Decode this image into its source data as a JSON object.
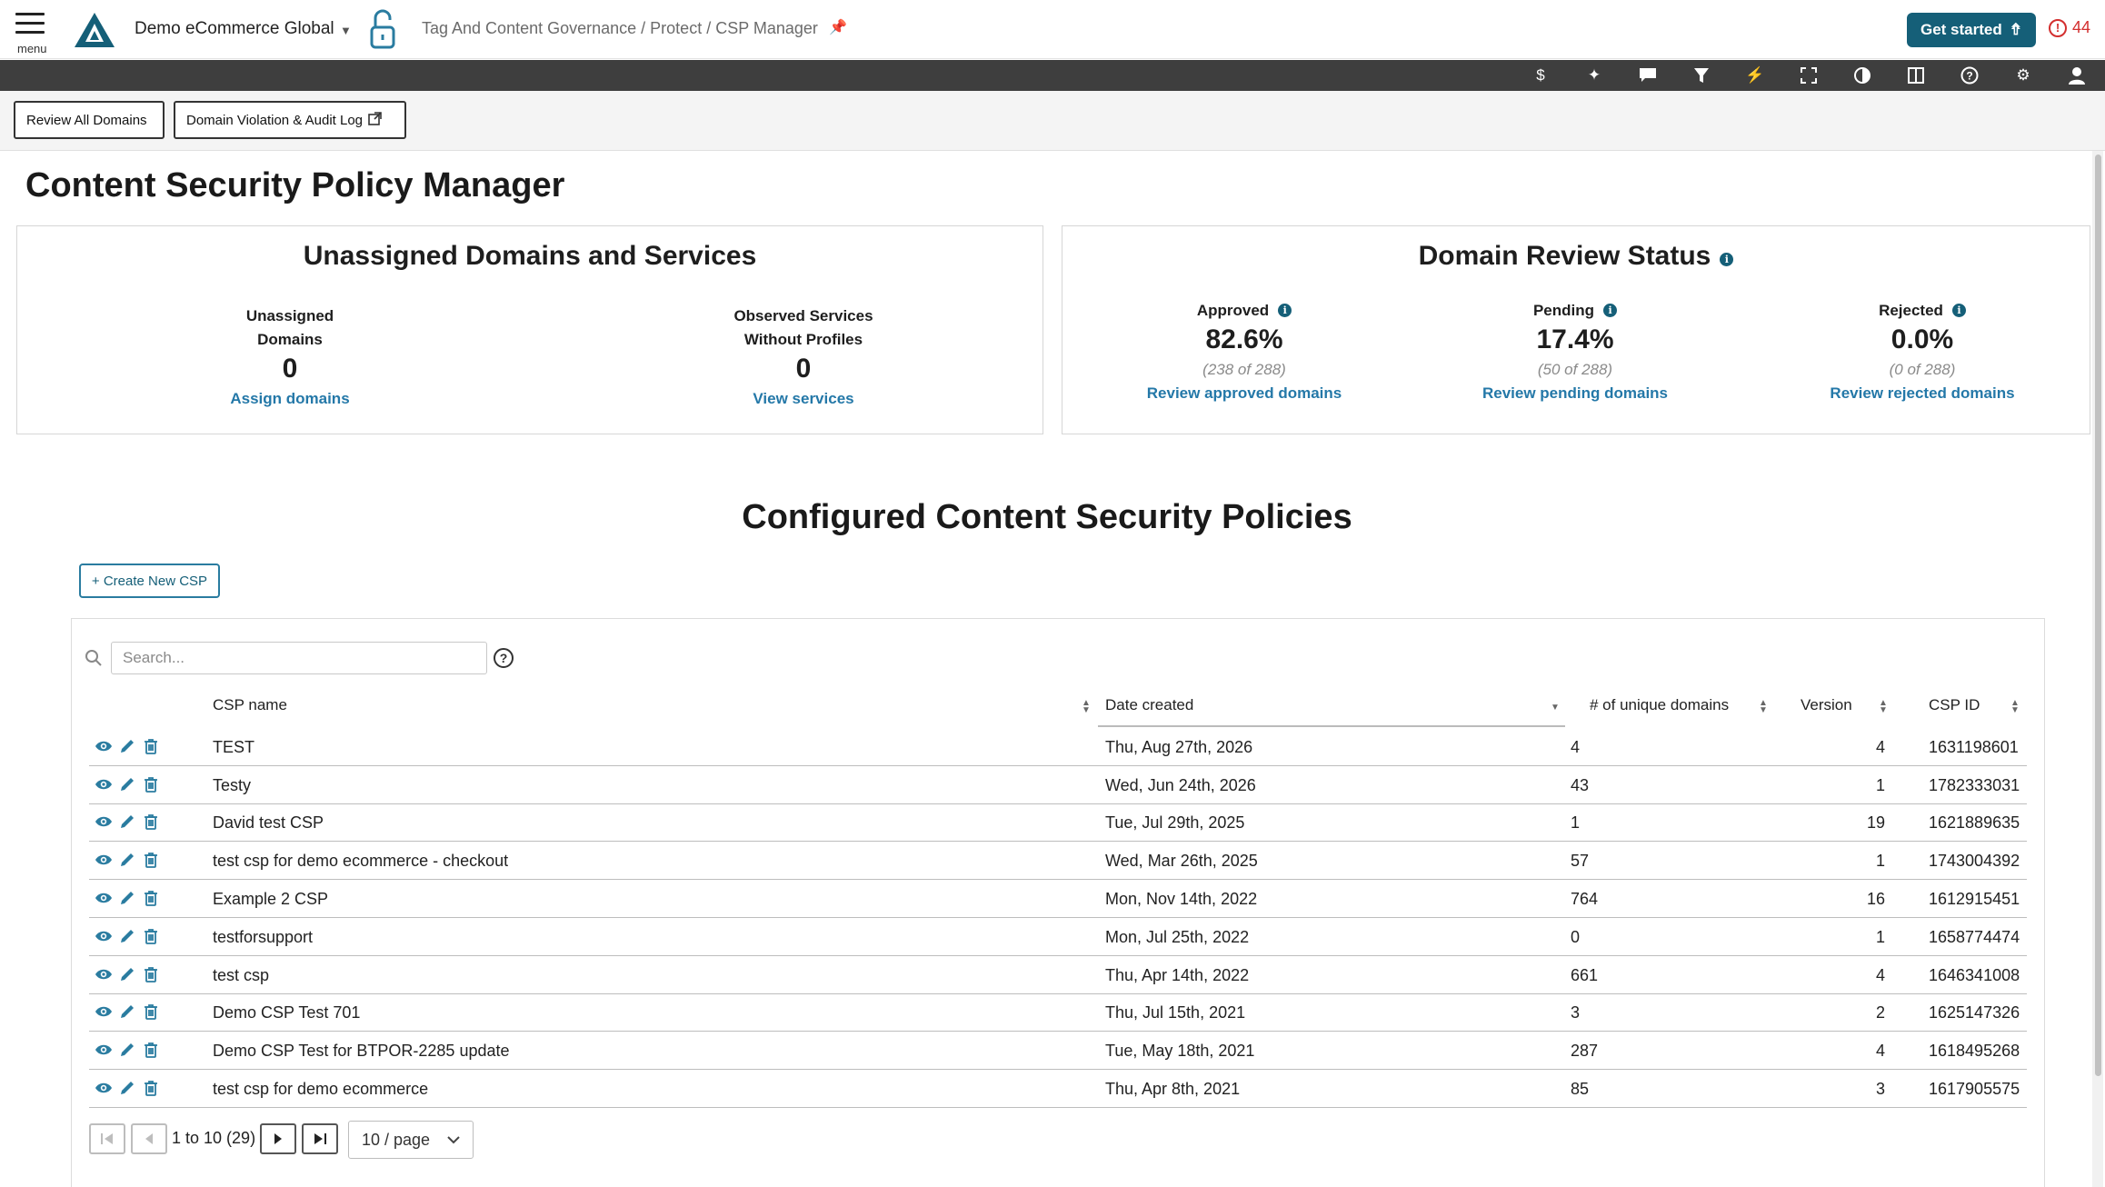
{
  "header": {
    "menu_label": "menu",
    "account": "Demo eCommerce Global",
    "breadcrumb": "Tag And Content Governance / Protect / CSP Manager",
    "get_started": "Get started",
    "alert_count": "44"
  },
  "toolbar": {
    "icons": [
      "dollar-icon",
      "sparkle-icon",
      "chat-icon",
      "filter-icon",
      "bolt-icon",
      "fullscreen-icon",
      "contrast-icon",
      "columns-icon",
      "help-icon",
      "settings-icon",
      "user-icon"
    ]
  },
  "actions": {
    "review_all": "Review All Domains",
    "violation_log": "Domain Violation & Audit Log"
  },
  "page_title": "Content Security Policy Manager",
  "unassigned": {
    "title": "Unassigned Domains and Services",
    "domains_label_1": "Unassigned",
    "domains_label_2": "Domains",
    "domains_value": "0",
    "domains_link": "Assign domains",
    "services_label_1": "Observed Services",
    "services_label_2": "Without Profiles",
    "services_value": "0",
    "services_link": "View services"
  },
  "review_status": {
    "title": "Domain Review Status",
    "approved": {
      "label": "Approved",
      "value": "82.6%",
      "sub": "(238 of 288)",
      "link": "Review approved domains"
    },
    "pending": {
      "label": "Pending",
      "value": "17.4%",
      "sub": "(50 of 288)",
      "link": "Review pending domains"
    },
    "rejected": {
      "label": "Rejected",
      "value": "0.0%",
      "sub": "(0 of 288)",
      "link": "Review rejected domains"
    }
  },
  "section_title": "Configured Content Security Policies",
  "create_button": "+ Create New CSP",
  "search": {
    "placeholder": "Search..."
  },
  "table": {
    "columns": {
      "name": "CSP name",
      "date": "Date created",
      "domains": "# of unique domains",
      "version": "Version",
      "id": "CSP ID"
    },
    "rows": [
      {
        "name": "TEST",
        "date": "Thu, Aug 27th, 2026",
        "domains": "4",
        "version": "4",
        "id": "1631198601"
      },
      {
        "name": "Testy",
        "date": "Wed, Jun 24th, 2026",
        "domains": "43",
        "version": "1",
        "id": "1782333031"
      },
      {
        "name": "David test CSP",
        "date": "Tue, Jul 29th, 2025",
        "domains": "1",
        "version": "19",
        "id": "1621889635"
      },
      {
        "name": "test csp for demo ecommerce - checkout",
        "date": "Wed, Mar 26th, 2025",
        "domains": "57",
        "version": "1",
        "id": "1743004392"
      },
      {
        "name": "Example 2 CSP",
        "date": "Mon, Nov 14th, 2022",
        "domains": "764",
        "version": "16",
        "id": "1612915451"
      },
      {
        "name": "testforsupport",
        "date": "Mon, Jul 25th, 2022",
        "domains": "0",
        "version": "1",
        "id": "1658774474"
      },
      {
        "name": "test csp",
        "date": "Thu, Apr 14th, 2022",
        "domains": "661",
        "version": "4",
        "id": "1646341008"
      },
      {
        "name": "Demo CSP Test 701",
        "date": "Thu, Jul 15th, 2021",
        "domains": "3",
        "version": "2",
        "id": "1625147326"
      },
      {
        "name": "Demo CSP Test for BTPOR-2285 update",
        "date": "Tue, May 18th, 2021",
        "domains": "287",
        "version": "4",
        "id": "1618495268"
      },
      {
        "name": "test csp for demo ecommerce",
        "date": "Thu, Apr 8th, 2021",
        "domains": "85",
        "version": "3",
        "id": "1617905575"
      }
    ]
  },
  "pagination": {
    "range": "1 to 10 (29)",
    "page_size": "10 / page"
  },
  "colors": {
    "brand": "#155f78",
    "link": "#2478a8",
    "toolbar": "#3e3e3e",
    "alert": "#d32f2f"
  }
}
